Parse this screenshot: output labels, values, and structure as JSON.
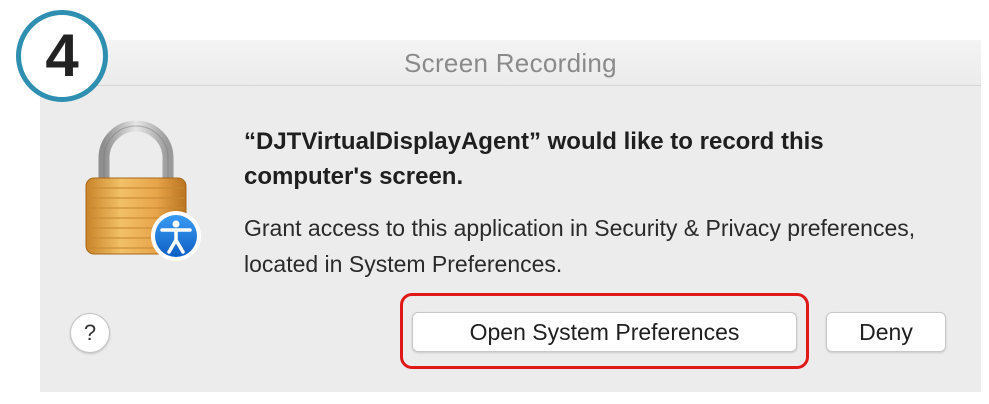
{
  "step": {
    "number": "4"
  },
  "dialog": {
    "title": "Screen Recording",
    "headline": "“DJTVirtualDisplayAgent” would like to record this computer's screen.",
    "body": "Grant access to this application in Security & Privacy preferences, located in System Preferences.",
    "icon": "lock-with-accessibility-badge-icon"
  },
  "buttons": {
    "help_label": "?",
    "open_label": "Open System Preferences",
    "deny_label": "Deny"
  },
  "colors": {
    "badge_ring": "#2f8fb0",
    "highlight": "#e01818",
    "accessibility_blue": "#1a73d9",
    "lock_gold": "#e8a54a"
  }
}
